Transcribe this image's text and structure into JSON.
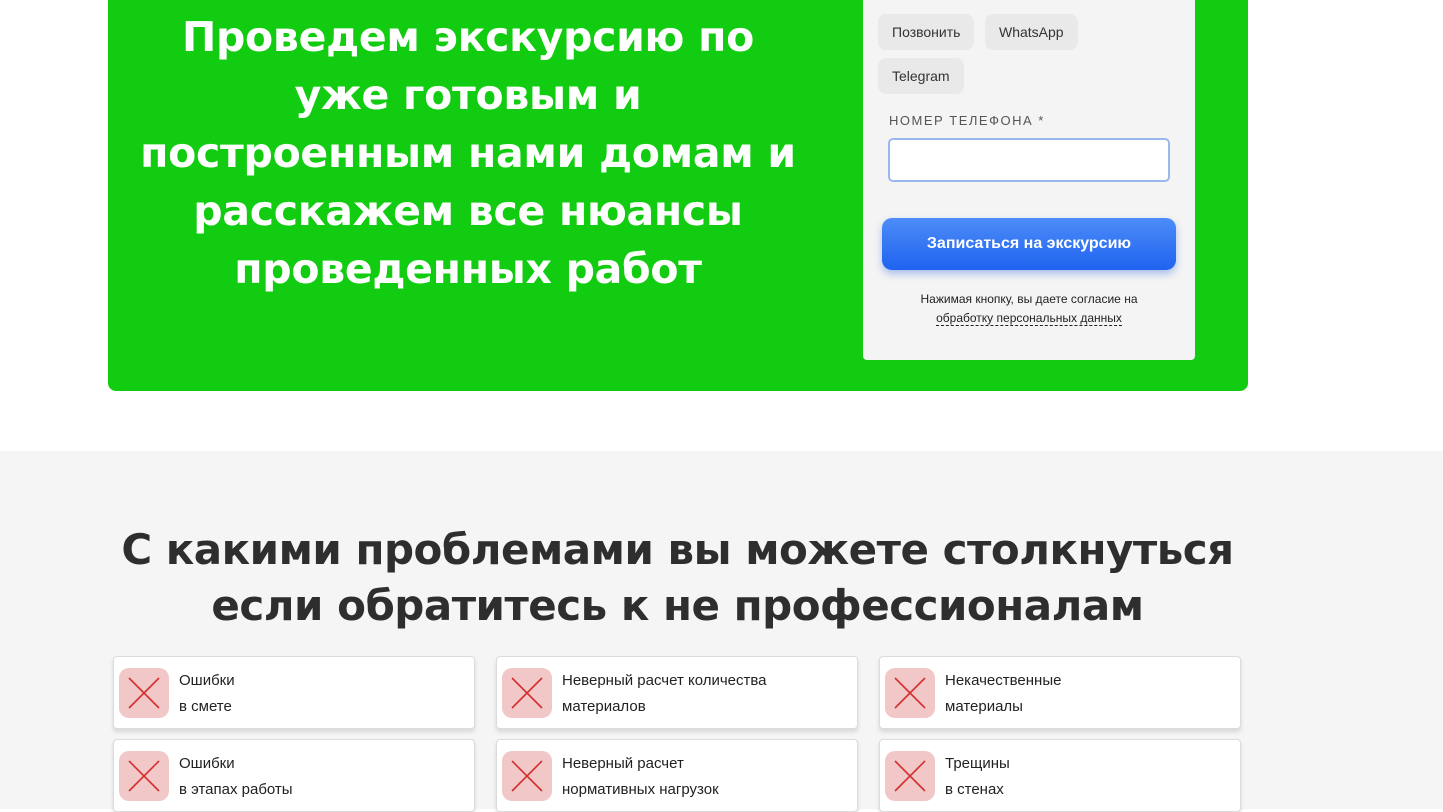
{
  "hero": {
    "title": "Проведем экскурсию по уже готовым и построенным нами домам и расскажем все нюансы проведенных работ"
  },
  "form": {
    "contact_buttons": [
      "Позвонить",
      "WhatsApp",
      "Telegram"
    ],
    "phone_label": "Номер телефона *",
    "phone_value": "",
    "submit_label": "Записаться на экскурсию",
    "consent_text": "Нажимая кнопку, вы даете согласие на",
    "consent_link": "обработку персональных данных"
  },
  "problems": {
    "title_line1": "С какими проблемами вы можете столкнуться",
    "title_line2": "если обратитесь к не профессионалам",
    "icon": "cross-icon",
    "items": [
      {
        "line1": "Ошибки",
        "line2": "в смете"
      },
      {
        "line1": "Неверный расчет количества",
        "line2": "материалов"
      },
      {
        "line1": "Некачественные",
        "line2": "материалы"
      },
      {
        "line1": "Ошибки",
        "line2": "в этапах работы"
      },
      {
        "line1": "Неверный расчет",
        "line2": "нормативных нагрузок"
      },
      {
        "line1": "Трещины",
        "line2": "в стенах"
      }
    ]
  },
  "colors": {
    "hero_green": "#11cc11",
    "button_blue": "#2f74f3",
    "cross_red": "#d32f2f",
    "icon_bg": "#f2c7c7"
  }
}
